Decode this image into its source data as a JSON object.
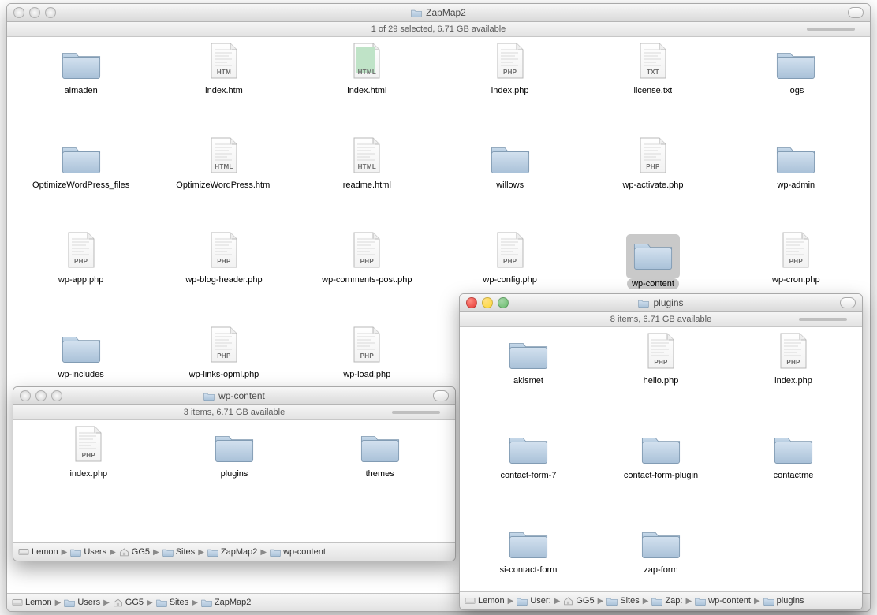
{
  "mainWindow": {
    "title": "ZapMap2",
    "status": "1 of 29 selected, 6.71 GB available",
    "path": [
      "Lemon",
      "Users",
      "GG5",
      "Sites",
      "ZapMap2"
    ],
    "items": [
      {
        "name": "almaden",
        "type": "folder"
      },
      {
        "name": "index.htm",
        "type": "file",
        "tag": "HTM"
      },
      {
        "name": "index.html",
        "type": "file",
        "tag": "HTML",
        "green": true
      },
      {
        "name": "index.php",
        "type": "file",
        "tag": "PHP"
      },
      {
        "name": "license.txt",
        "type": "file",
        "tag": "TXT"
      },
      {
        "name": "logs",
        "type": "folder"
      },
      {
        "name": "OptimizeWordPress_files",
        "type": "folder"
      },
      {
        "name": "OptimizeWordPress.html",
        "type": "file",
        "tag": "HTML"
      },
      {
        "name": "readme.html",
        "type": "file",
        "tag": "HTML"
      },
      {
        "name": "willows",
        "type": "folder"
      },
      {
        "name": "wp-activate.php",
        "type": "file",
        "tag": "PHP"
      },
      {
        "name": "wp-admin",
        "type": "folder"
      },
      {
        "name": "wp-app.php",
        "type": "file",
        "tag": "PHP"
      },
      {
        "name": "wp-blog-header.php",
        "type": "file",
        "tag": "PHP"
      },
      {
        "name": "wp-comments-post.php",
        "type": "file",
        "tag": "PHP"
      },
      {
        "name": "wp-config.php",
        "type": "file",
        "tag": "PHP"
      },
      {
        "name": "wp-content",
        "type": "folder",
        "selected": true
      },
      {
        "name": "wp-cron.php",
        "type": "file",
        "tag": "PHP"
      },
      {
        "name": "wp-includes",
        "type": "folder"
      },
      {
        "name": "wp-links-opml.php",
        "type": "file",
        "tag": "PHP"
      },
      {
        "name": "wp-load.php",
        "type": "file",
        "tag": "PHP"
      }
    ]
  },
  "contentWindow": {
    "title": "wp-content",
    "status": "3 items, 6.71 GB available",
    "path": [
      "Lemon",
      "Users",
      "GG5",
      "Sites",
      "ZapMap2",
      "wp-content"
    ],
    "items": [
      {
        "name": "index.php",
        "type": "file",
        "tag": "PHP"
      },
      {
        "name": "plugins",
        "type": "folder"
      },
      {
        "name": "themes",
        "type": "folder"
      }
    ]
  },
  "pluginsWindow": {
    "title": "plugins",
    "status": "8 items, 6.71 GB available",
    "path": [
      "Lemon",
      "Users",
      "GG5",
      "Sites",
      "ZapMap2",
      "wp-content",
      "plugins"
    ],
    "pathTrunc": [
      "Lemon",
      "User:",
      "GG5",
      "Sites",
      "Zap:",
      "wp-content",
      "plugins"
    ],
    "items": [
      {
        "name": "akismet",
        "type": "folder"
      },
      {
        "name": "hello.php",
        "type": "file",
        "tag": "PHP"
      },
      {
        "name": "index.php",
        "type": "file",
        "tag": "PHP"
      },
      {
        "name": "contact-form-7",
        "type": "folder"
      },
      {
        "name": "contact-form-plugin",
        "type": "folder"
      },
      {
        "name": "contactme",
        "type": "folder"
      },
      {
        "name": "si-contact-form",
        "type": "folder"
      },
      {
        "name": "zap-form",
        "type": "folder"
      }
    ]
  }
}
